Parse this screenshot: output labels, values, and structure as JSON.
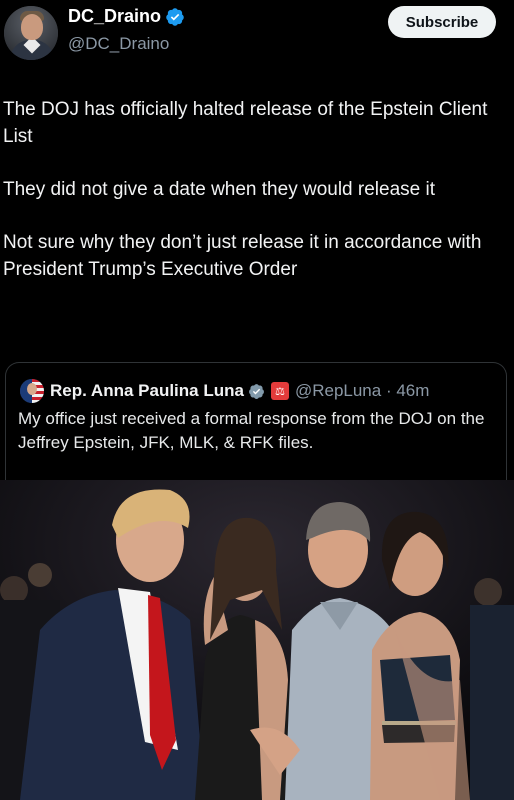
{
  "author": {
    "name": "DC_Draino",
    "handle": "@DC_Draino",
    "verified_icon": "verified-badge-icon",
    "accent": "#1d9bf0"
  },
  "subscribe_label": "Subscribe",
  "tweet": {
    "paragraphs": [
      "The DOJ has officially halted release of the Epstein Client List",
      "They did not give a date when they would release it",
      "Not sure why they don’t just release it in accordance with President Trump’s Executive Order"
    ]
  },
  "quote": {
    "name": "Rep. Anna Paulina Luna",
    "handle_time": "@RepLuna · 46m",
    "text": "My office just received a formal response from the DOJ on the Jeffrey Epstein, JFK, MLK, & RFK files.",
    "badges": [
      "verified-badge-icon",
      "government-badge-icon"
    ]
  },
  "photo": {
    "icon": "photo-icon",
    "colors": {
      "suit": "#1f2a44",
      "tie": "#c4161c",
      "dress": "#1a1a1a",
      "skin": "#c89a80"
    }
  }
}
